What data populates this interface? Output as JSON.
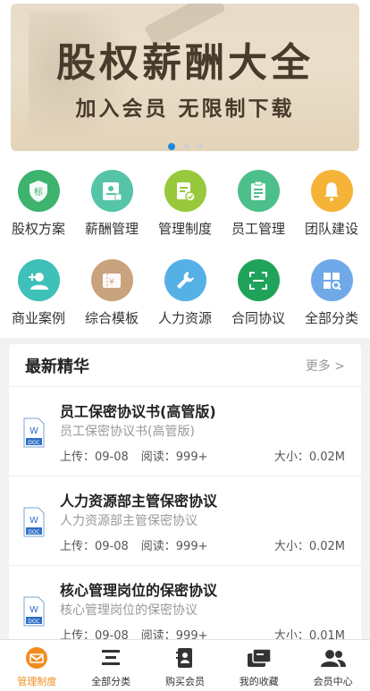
{
  "banner": {
    "title": "股权薪酬大全",
    "subtitle": "加入会员 无限制下载",
    "slides": 3,
    "active_slide": 1,
    "colors": {
      "text": "#4a3a2c",
      "dot_active": "#1e88e5"
    }
  },
  "grid": {
    "row1": [
      {
        "label": "股权方案",
        "icon": "shield-icon",
        "color": "#3db36e"
      },
      {
        "label": "薪酬管理",
        "icon": "id-card-icon",
        "color": "#55c4a7"
      },
      {
        "label": "管理制度",
        "icon": "document-check-icon",
        "color": "#98c93c"
      },
      {
        "label": "员工管理",
        "icon": "clipboard-icon",
        "color": "#4cbf8a"
      },
      {
        "label": "团队建设",
        "icon": "bell-icon",
        "color": "#f5b338"
      }
    ],
    "row2": [
      {
        "label": "商业案例",
        "icon": "add-user-icon",
        "color": "#3fc0b8"
      },
      {
        "label": "综合模板",
        "icon": "ticket-icon",
        "color": "#c9a27e"
      },
      {
        "label": "人力资源",
        "icon": "wrench-icon",
        "color": "#55b0e6"
      },
      {
        "label": "合同协议",
        "icon": "scan-icon",
        "color": "#1fa35a"
      },
      {
        "label": "全部分类",
        "icon": "grid-search-icon",
        "color": "#6fa9e8"
      }
    ]
  },
  "latest": {
    "title": "最新精华",
    "more": "更多 >",
    "items": [
      {
        "title": "员工保密协议书(高管版)",
        "subtitle": "员工保密协议书(高管版)",
        "upload": "上传：09-08",
        "reads": "阅读：999+",
        "size": "大小：0.02M",
        "badge": "DOC",
        "letter": "W"
      },
      {
        "title": "人力资源部主管保密协议",
        "subtitle": "人力资源部主管保密协议",
        "upload": "上传：09-08",
        "reads": "阅读：999+",
        "size": "大小：0.02M",
        "badge": "DOC",
        "letter": "W"
      },
      {
        "title": "核心管理岗位的保密协议",
        "subtitle": "核心管理岗位的保密协议",
        "upload": "上传：09-08",
        "reads": "阅读：999+",
        "size": "大小：0.01M",
        "badge": "DOC",
        "letter": "W"
      }
    ]
  },
  "tabbar": {
    "active_color": "#f08c1f",
    "items": [
      {
        "label": "管理制度",
        "icon": "mail-icon",
        "active": true
      },
      {
        "label": "全部分类",
        "icon": "menu-icon",
        "active": false
      },
      {
        "label": "购买会员",
        "icon": "contacts-icon",
        "active": false
      },
      {
        "label": "我的收藏",
        "icon": "collection-icon",
        "active": false
      },
      {
        "label": "会员中心",
        "icon": "users-icon",
        "active": false
      }
    ]
  }
}
